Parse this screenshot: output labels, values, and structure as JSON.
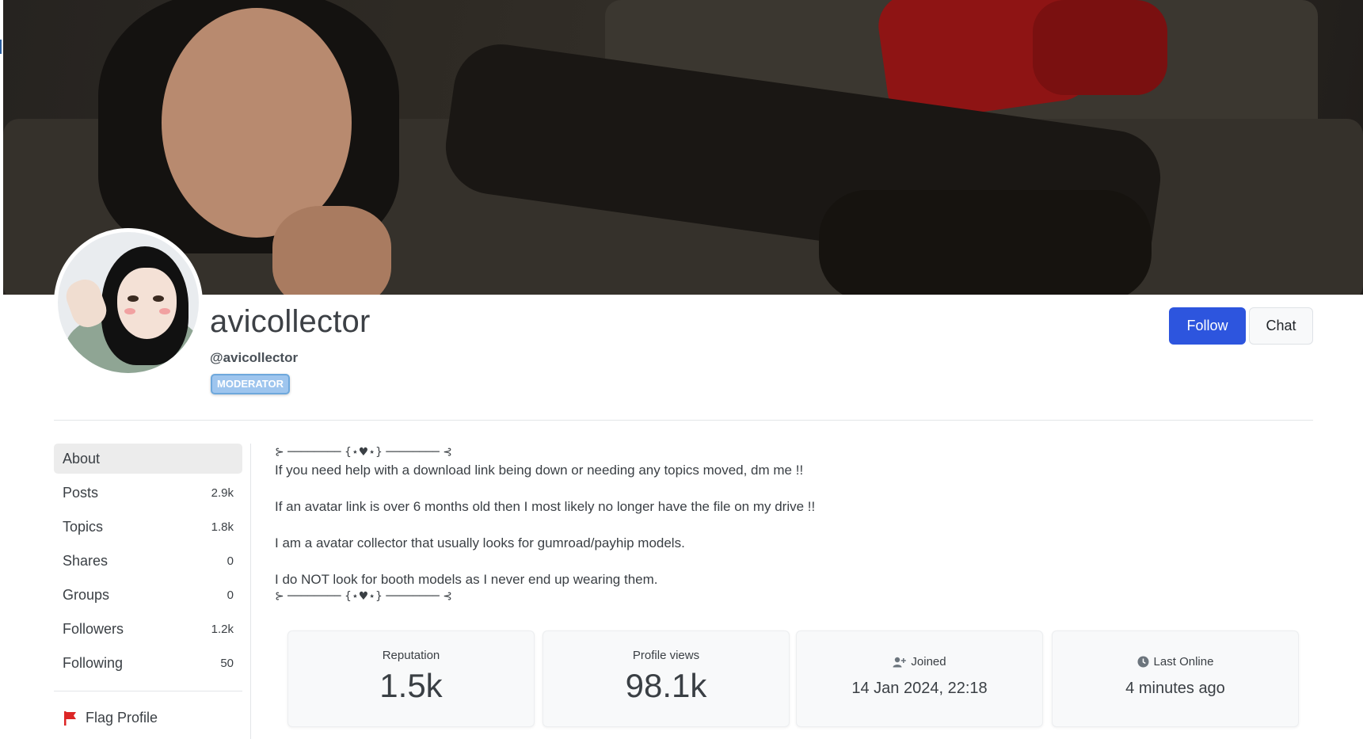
{
  "profile": {
    "username": "avicollector",
    "handle": "@avicollector",
    "badge": "MODERATOR",
    "badge_color": "#9ec5ee"
  },
  "actions": {
    "follow_label": "Follow",
    "chat_label": "Chat",
    "accent": "#2d55de"
  },
  "sidebar": {
    "items": [
      {
        "label": "About",
        "count": "",
        "active": true
      },
      {
        "label": "Posts",
        "count": "2.9k"
      },
      {
        "label": "Topics",
        "count": "1.8k"
      },
      {
        "label": "Shares",
        "count": "0"
      },
      {
        "label": "Groups",
        "count": "0"
      },
      {
        "label": "Followers",
        "count": "1.2k"
      },
      {
        "label": "Following",
        "count": "50"
      }
    ],
    "flag_label": "Flag Profile",
    "flag_icon": "flag-icon",
    "flag_color": "#dc2626"
  },
  "about": {
    "deco_top": "⊱ ──────── {⋆♥⋆} ──────── ⊰",
    "lines": [
      "If you need help with a download link being down or needing any topics moved, dm me !!",
      "If an avatar link is over 6 months old then I most likely no longer have the file on my drive !!",
      "I am a avatar collector that usually looks for gumroad/payhip models.",
      "I do NOT look for booth models as I never end up wearing them."
    ],
    "deco_bottom": "⊱ ──────── {⋆♥⋆} ──────── ⊰"
  },
  "stats": [
    {
      "title": "Reputation",
      "value": "1.5k"
    },
    {
      "title": "Profile views",
      "value": "98.1k"
    },
    {
      "title": "Joined",
      "value": "14 Jan 2024, 22:18",
      "icon": "user-plus-icon"
    },
    {
      "title": "Last Online",
      "value": "4 minutes ago",
      "icon": "clock-icon"
    }
  ]
}
